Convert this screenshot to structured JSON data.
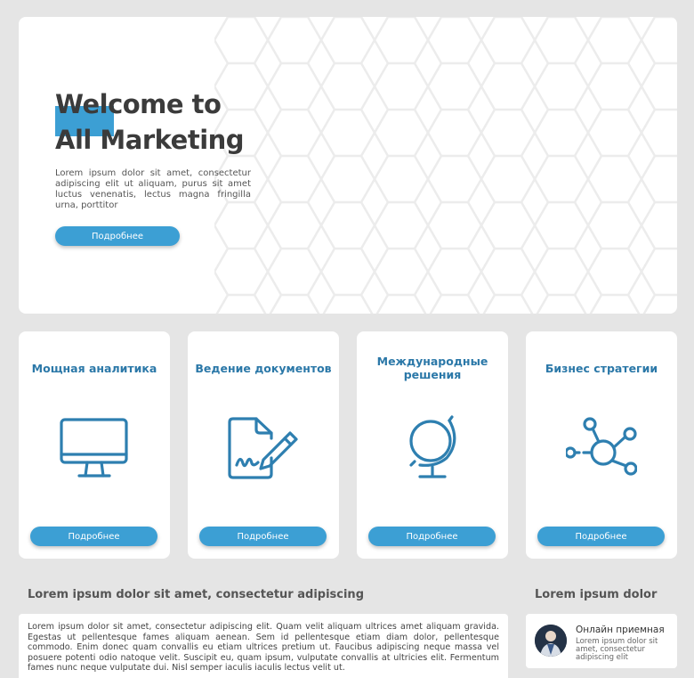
{
  "hero": {
    "title_line1": "Welcome to",
    "title_line2": "All Marketing",
    "text": "Lorem ipsum dolor sit amet, consectetur adipiscing elit ut aliquam, purus sit amet luctus venenatis, lectus magna fringilla urna, porttitor",
    "button_label": "Подробнее"
  },
  "cards": [
    {
      "title": "Мощная аналитика",
      "icon": "monitor-icon",
      "button_label": "Подробнее"
    },
    {
      "title": "Ведение документов",
      "icon": "document-sign-icon",
      "button_label": "Подробнее"
    },
    {
      "title": "Международные решения",
      "icon": "globe-icon",
      "button_label": "Подробнее"
    },
    {
      "title": "Бизнес стратегии",
      "icon": "network-icon",
      "button_label": "Подробнее"
    }
  ],
  "main_section": {
    "title": "Lorem ipsum dolor sit amet, consectetur adipiscing",
    "text": "Lorem ipsum dolor sit amet, consectetur adipiscing elit. Quam velit aliquam ultrices amet aliquam gravida. Egestas ut pellentesque fames aliquam aenean. Sem id pellentesque etiam diam dolor, pellentesque commodo. Enim donec quam convallis eu etiam ultrices pretium ut. Faucibus adipiscing neque massa vel posuere potenti odio natoque velit. Suscipit eu, quam ipsum, vulputate convallis at ultricies elit. Fermentum fames nunc neque vulputate dui. Nisl semper iaculis iaculis lectus velit ut."
  },
  "side_section": {
    "title": "Lorem ipsum dolor",
    "item_title": "Онлайн приемная",
    "item_text": "Lorem ipsum dolor sit amet, consectetur adipiscing elit"
  },
  "colors": {
    "accent": "#3c9fd4",
    "card_title": "#2b78a8",
    "icon_stroke": "#2e7fb0",
    "background": "#e5e5e5"
  }
}
